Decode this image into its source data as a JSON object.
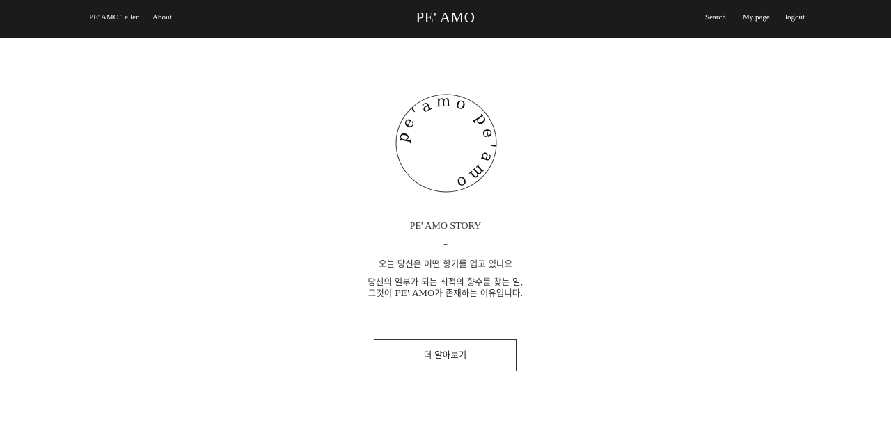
{
  "header": {
    "nav_left": [
      "PE' AMO Teller",
      "About"
    ],
    "brand": "PE' AMO",
    "nav_right": [
      "Search",
      "My page",
      "logout"
    ]
  },
  "emblem": {
    "text": "pe'amo pe'amo",
    "stroke_color": "#333333"
  },
  "story": {
    "title": "PE' AMO STORY",
    "dash": "–",
    "line1": "오늘 당신은 어떤 향기를 입고 있나요",
    "line2": "당신의 일부가 되는 최적의 향수를 찾는 일,",
    "line3": "그것이 PE' AMO가 존재하는 이유입니다."
  },
  "cta": {
    "label": "더 알아보기"
  },
  "colors": {
    "header_bg": "#1b1b1b",
    "header_text": "#ffffff",
    "body_text": "#333333",
    "page_bg": "#ffffff"
  }
}
